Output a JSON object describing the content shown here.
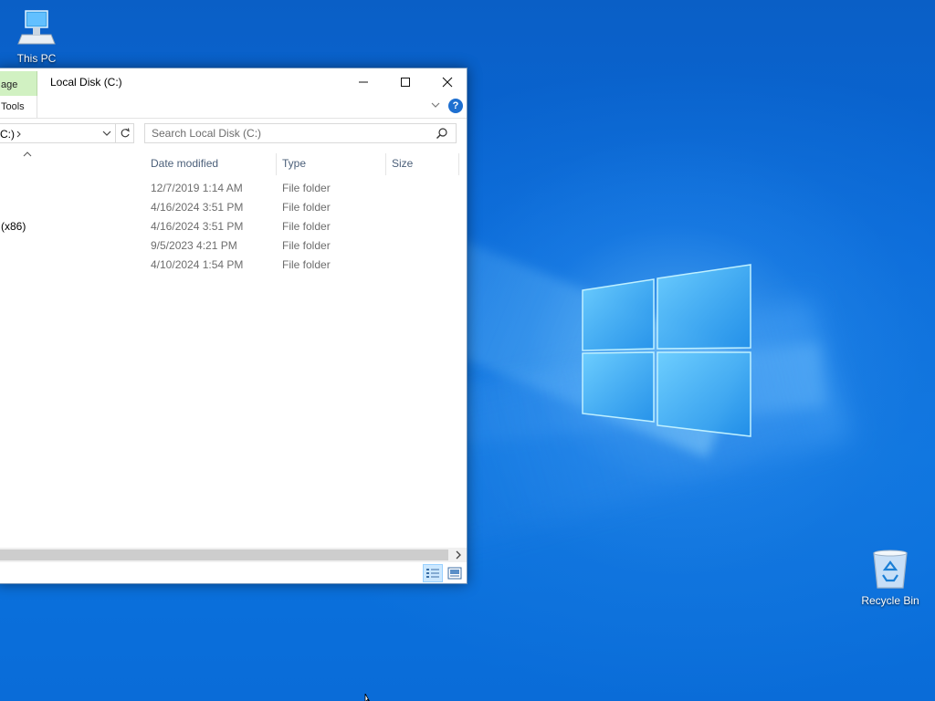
{
  "desktop": {
    "icons": [
      {
        "label": "This PC"
      },
      {
        "label": "Recycle Bin"
      }
    ]
  },
  "window": {
    "title": "Local Disk (C:)",
    "manage_tab": "age",
    "tools_tab": "Tools",
    "help_label": "?"
  },
  "address": {
    "path_fragment": "C:)",
    "search_placeholder": "Search Local Disk (C:)"
  },
  "columns": {
    "date_modified": "Date modified",
    "type": "Type",
    "size": "Size"
  },
  "files": [
    {
      "name": "",
      "date": "12/7/2019 1:14 AM",
      "type": "File folder"
    },
    {
      "name": "",
      "date": "4/16/2024 3:51 PM",
      "type": "File folder"
    },
    {
      "name": "(x86)",
      "date": "4/16/2024 3:51 PM",
      "type": "File folder"
    },
    {
      "name": "",
      "date": "9/5/2023 4:21 PM",
      "type": "File folder"
    },
    {
      "name": "",
      "date": "4/10/2024 1:54 PM",
      "type": "File folder"
    }
  ],
  "colors": {
    "desktop_blue": "#0868d8",
    "manage_tab_green": "#d1f1c2",
    "selected_view": "#cce8ff"
  }
}
